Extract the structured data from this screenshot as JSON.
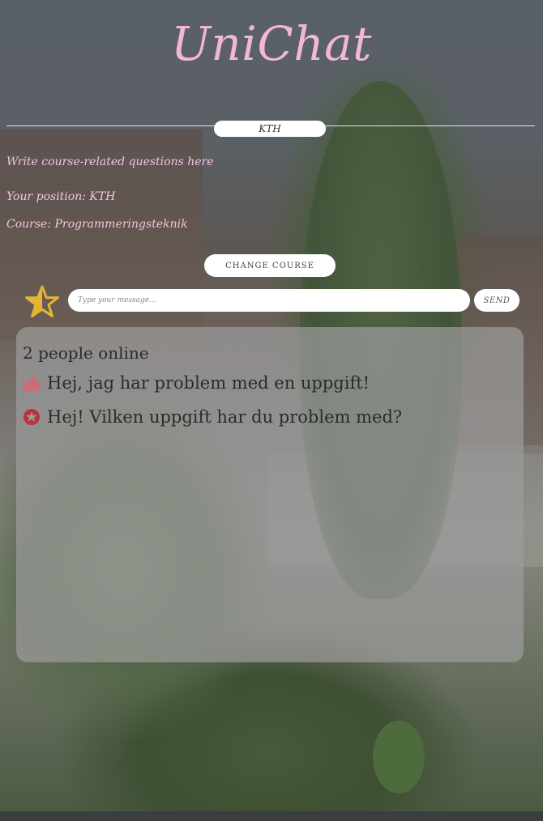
{
  "app": {
    "title": "UniChat"
  },
  "university": {
    "label": "KTH"
  },
  "info": {
    "prompt": "Write course-related questions here",
    "position": "Your position: KTH",
    "course": "Course: Programmeringsteknik"
  },
  "buttons": {
    "change_course": "CHANGE COURSE",
    "send": "SEND"
  },
  "composer": {
    "placeholder": "Type your message...",
    "star_icon": "star-icon",
    "star_color": "#e5b435"
  },
  "chat": {
    "online": "2 people online",
    "messages": [
      {
        "icon": "thumbs-up-icon",
        "icon_color": "#d06a78",
        "text": "Hej, jag har problem med en uppgift!"
      },
      {
        "icon": "star-badge-icon",
        "icon_color": "#b8343f",
        "text": "Hej! Vilken uppgift har du problem med?"
      }
    ]
  },
  "colors": {
    "accent_pink": "#f2b6da",
    "panel": "#9b9b9b"
  }
}
